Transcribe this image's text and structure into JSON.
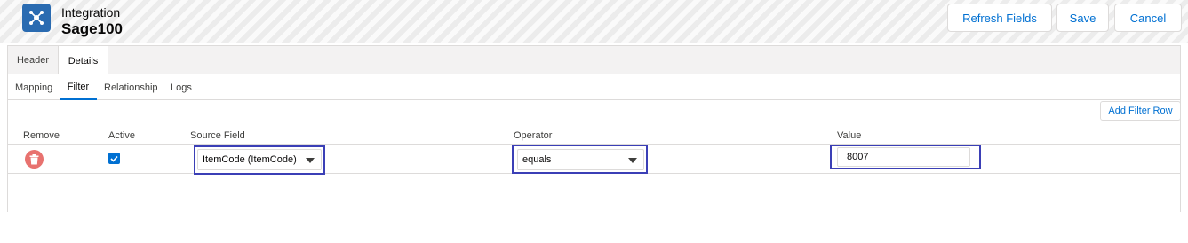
{
  "header": {
    "app_icon": "integration-nodes-icon",
    "object_label": "Integration",
    "record_name": "Sage100",
    "buttons": {
      "refresh_fields": "Refresh Fields",
      "save": "Save",
      "cancel": "Cancel"
    }
  },
  "tabs": {
    "items": [
      {
        "label": "Header"
      },
      {
        "label": "Details",
        "active": true
      }
    ]
  },
  "subtabs": {
    "items": [
      {
        "label": "Mapping"
      },
      {
        "label": "Filter",
        "active": true
      },
      {
        "label": "Relationship"
      },
      {
        "label": "Logs"
      }
    ]
  },
  "filter": {
    "add_row_label": "Add Filter Row",
    "columns": {
      "remove": "Remove",
      "active": "Active",
      "source_field": "Source Field",
      "operator": "Operator",
      "value": "Value"
    },
    "rows": [
      {
        "remove_icon": "trash-icon",
        "active": true,
        "source_field": "ItemCode (ItemCode)",
        "operator": "equals",
        "value": "8007"
      }
    ]
  },
  "colors": {
    "brand_blue": "#0070d2",
    "app_icon_bg": "#2a6bb1",
    "remove_red": "#e8726f",
    "highlight_box": "#3b3fb6"
  }
}
